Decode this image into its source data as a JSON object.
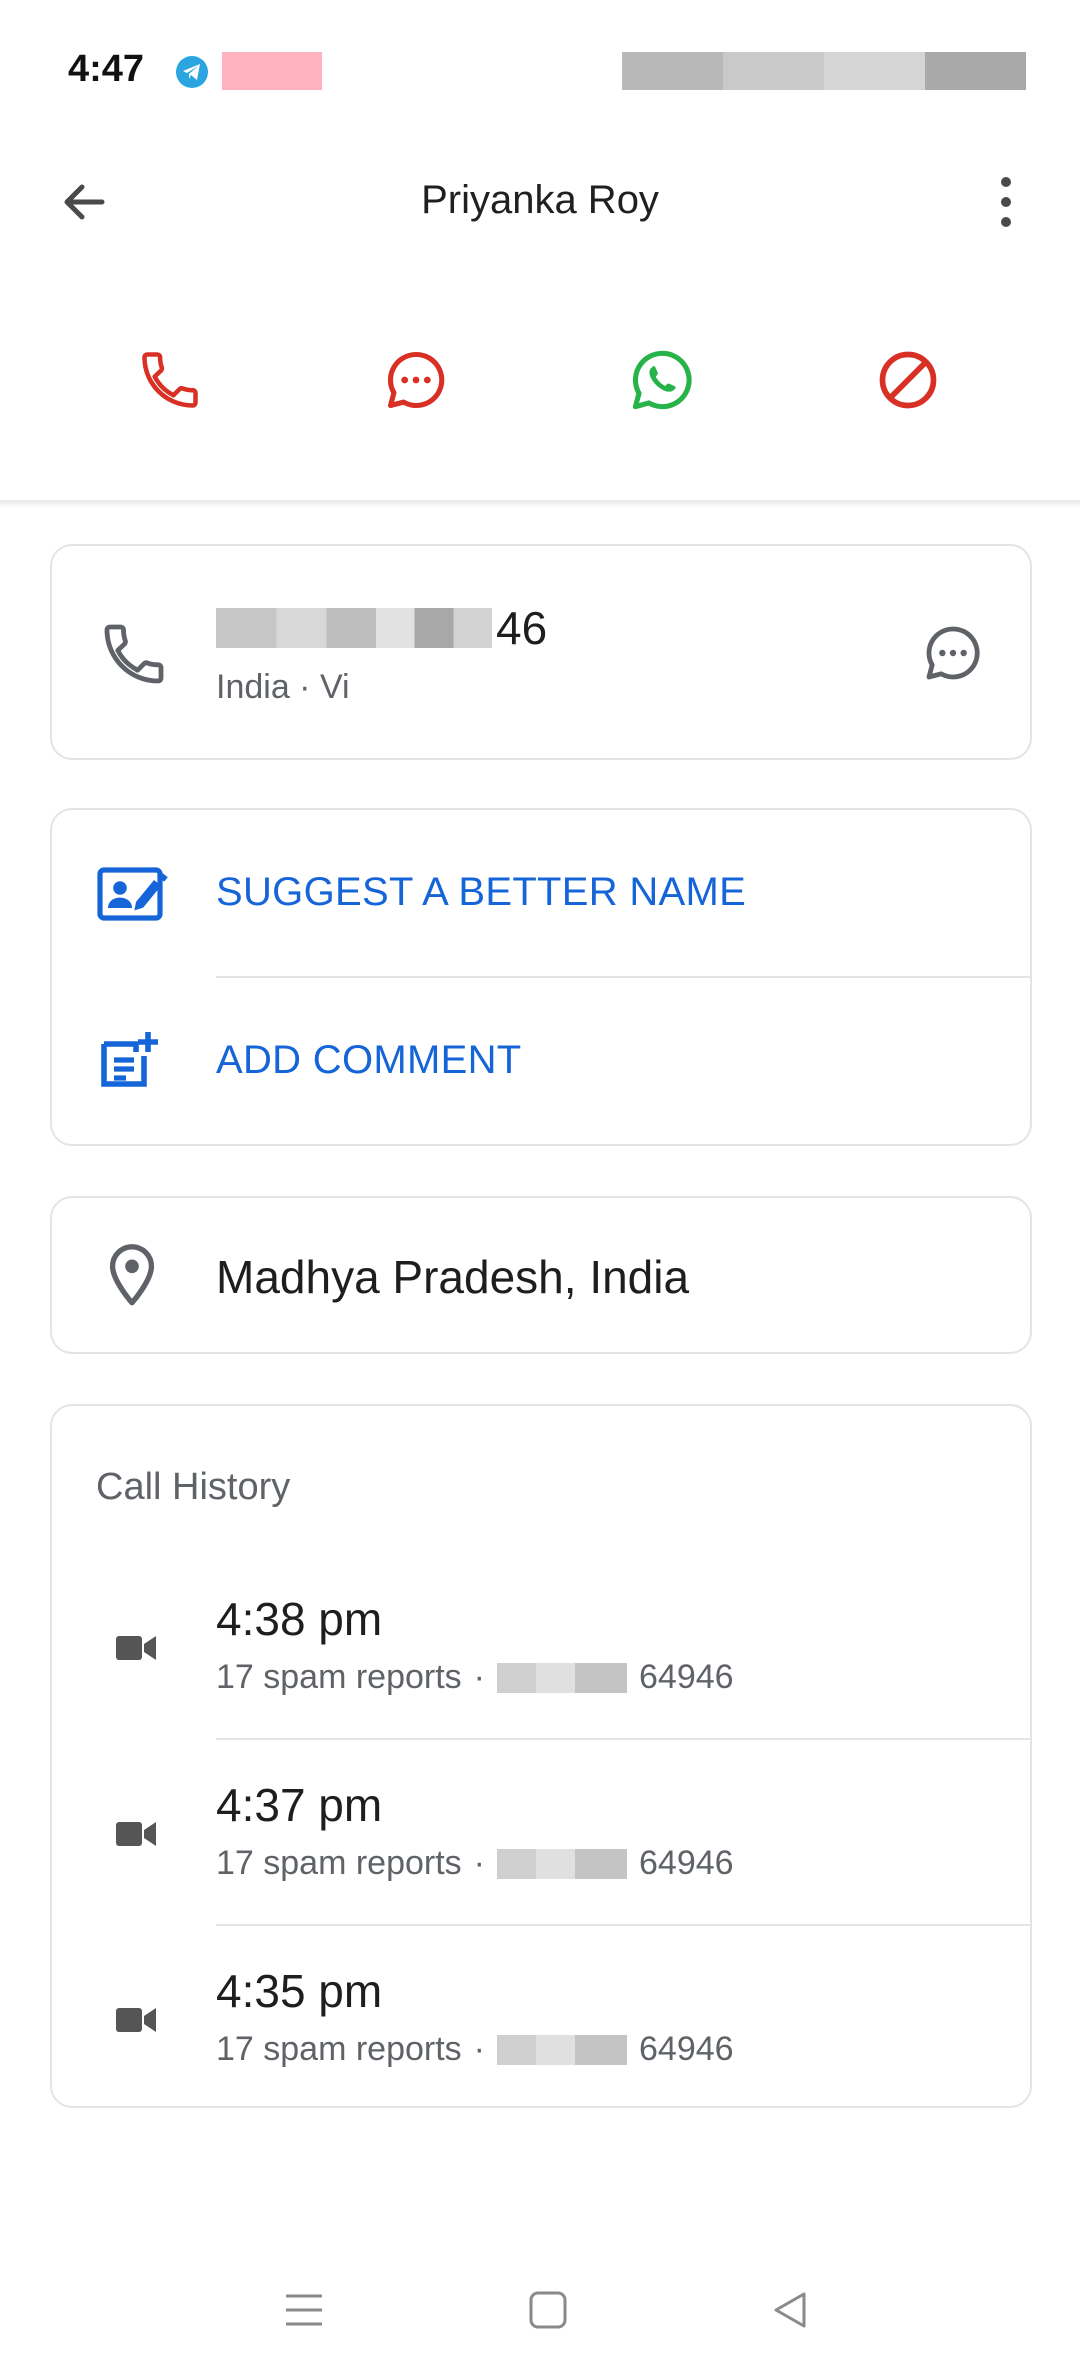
{
  "status_bar": {
    "time": "4:47",
    "icons": [
      "telegram-icon"
    ]
  },
  "header": {
    "title": "Priyanka Roy",
    "back_icon": "arrow-left-icon",
    "more_icon": "more-vertical-icon"
  },
  "actions": [
    {
      "name": "call",
      "icon": "phone-icon",
      "color": "#d93025"
    },
    {
      "name": "message",
      "icon": "chat-bubble-icon",
      "color": "#d93025"
    },
    {
      "name": "whatsapp",
      "icon": "whatsapp-icon",
      "color": "#25b34a"
    },
    {
      "name": "block",
      "icon": "block-icon",
      "color": "#d93025"
    }
  ],
  "phone_card": {
    "number_visible_suffix": "46",
    "subtitle": "India · Vi"
  },
  "suggest_card": {
    "suggest_label": "SUGGEST A BETTER NAME",
    "comment_label": "ADD COMMENT",
    "accent": "#1565d8"
  },
  "location": {
    "text": "Madhya Pradesh, India"
  },
  "call_history": {
    "title": "Call History",
    "items": [
      {
        "time": "4:38 pm",
        "reports": "17 spam reports",
        "number_suffix": "64946"
      },
      {
        "time": "4:37 pm",
        "reports": "17 spam reports",
        "number_suffix": "64946"
      },
      {
        "time": "4:35 pm",
        "reports": "17 spam reports",
        "number_suffix": "64946"
      }
    ]
  },
  "nav_bar": {
    "icons": [
      "menu-icon",
      "home-square-icon",
      "back-triangle-icon"
    ]
  }
}
